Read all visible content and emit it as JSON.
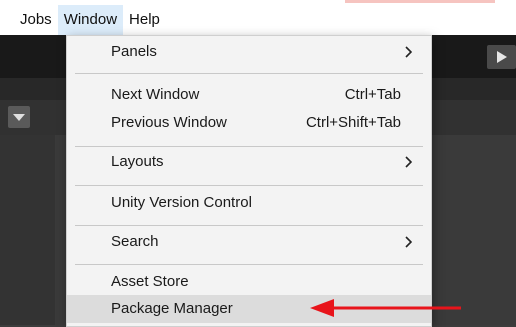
{
  "menubar": {
    "items": [
      "Jobs",
      "Window",
      "Help"
    ]
  },
  "window_menu": {
    "panels": "Panels",
    "next_window": "Next Window",
    "next_window_shortcut": "Ctrl+Tab",
    "previous_window": "Previous Window",
    "previous_window_shortcut": "Ctrl+Shift+Tab",
    "layouts": "Layouts",
    "unity_version_control": "Unity Version Control",
    "search": "Search",
    "asset_store": "Asset Store",
    "package_manager": "Package Manager"
  },
  "icons": {
    "submenu": "chevron-right-icon",
    "play": "play-icon",
    "dropdown": "chevron-down-icon",
    "annotation": "red-arrow-icon"
  },
  "colors": {
    "annotation_arrow": "#e8141b",
    "menu_bg": "#f3f3f3",
    "menubar_active": "#dcecfa"
  }
}
